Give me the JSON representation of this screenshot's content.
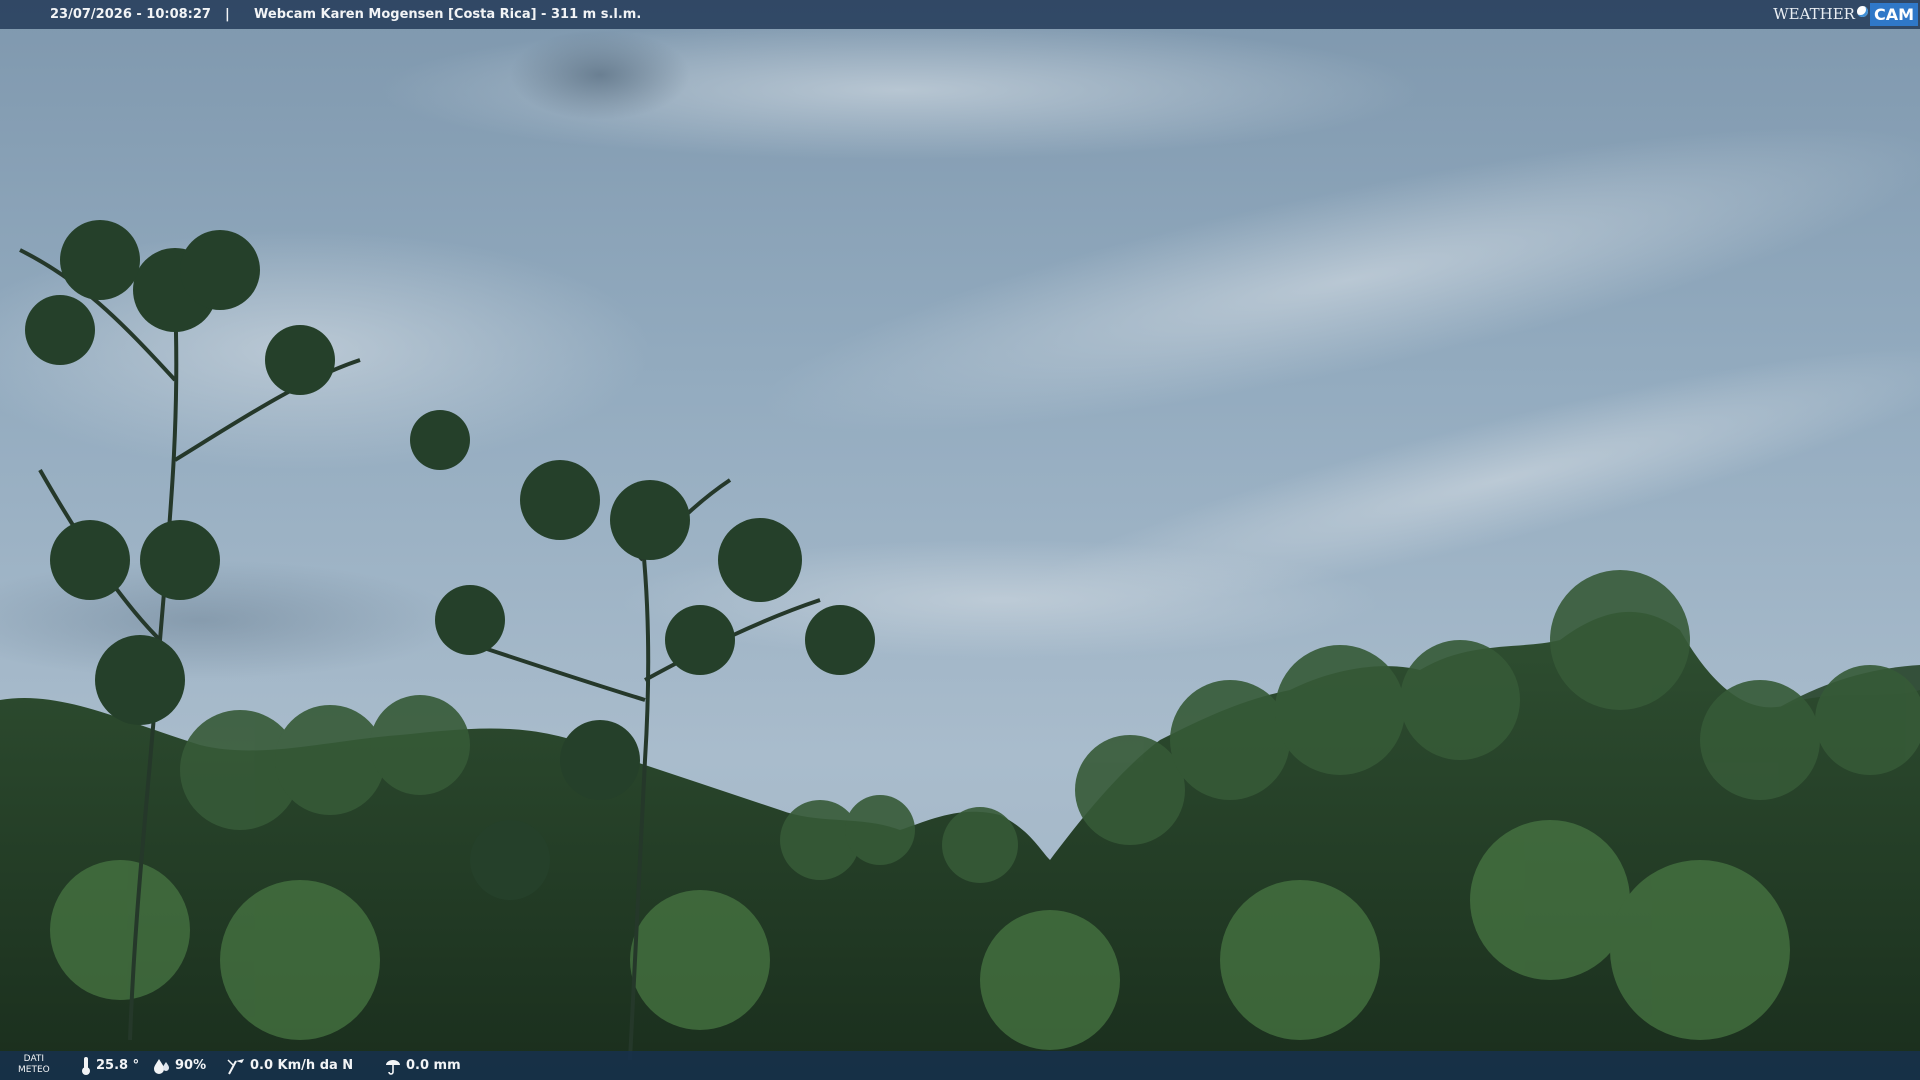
{
  "overlay": {
    "timestamp": "23/07/2026 - 10:08:27",
    "separator": "|",
    "title": "Webcam Karen Mogensen [Costa Rica] - 311 m s.l.m."
  },
  "logo": {
    "word": "WEATHER",
    "cam": "CAM",
    "accent": "#2f78c8"
  },
  "weather": {
    "label_line1": "DATI",
    "label_line2": "METEO",
    "temperature": "25.8 °",
    "humidity": "90%",
    "wind": "0.0 Km/h da N",
    "rain": "0.0 mm",
    "icons": [
      "thermometer-icon",
      "humidity-drops-icon",
      "wind-vane-icon",
      "rain-gauge-icon"
    ]
  },
  "scene": {
    "description_colors": {
      "sky_top": "#8ea6ba",
      "sky_bottom": "#aebfce",
      "forest_dark": "#1e3524",
      "forest_light": "#3f6a3c"
    }
  }
}
